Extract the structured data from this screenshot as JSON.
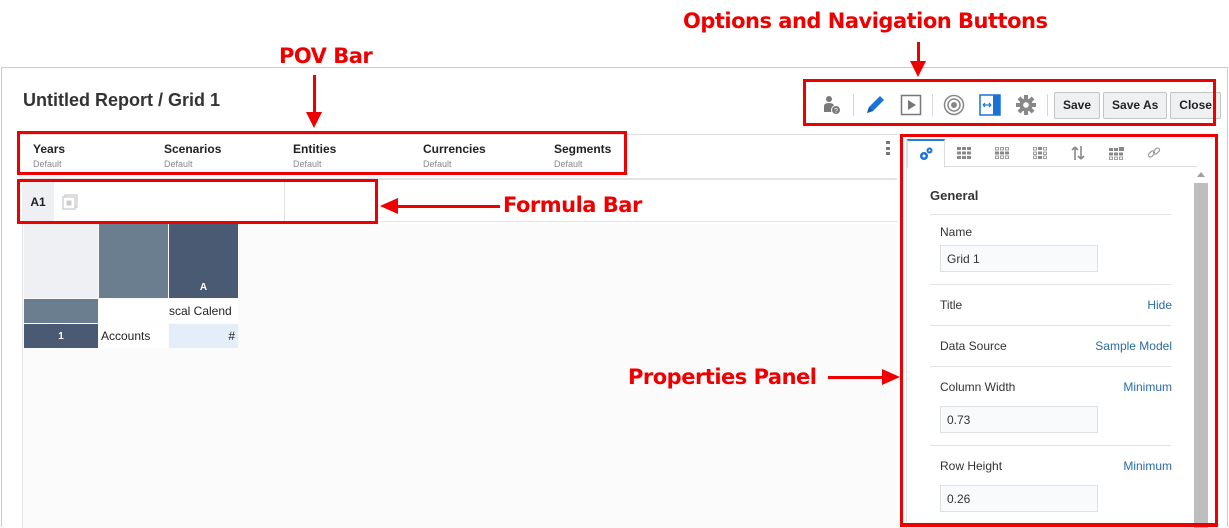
{
  "header": {
    "title": "Untitled Report / Grid 1"
  },
  "toolbar": {
    "icons": [
      "user-help-icon",
      "edit-icon",
      "preview-icon",
      "target-icon",
      "fit-width-icon",
      "settings-icon"
    ],
    "save_label": "Save",
    "save_as_label": "Save As",
    "close_label": "Close"
  },
  "pov": [
    {
      "dimension": "Years",
      "member": "Default"
    },
    {
      "dimension": "Scenarios",
      "member": "Default"
    },
    {
      "dimension": "Entities",
      "member": "Default"
    },
    {
      "dimension": "Currencies",
      "member": "Default"
    },
    {
      "dimension": "Segments",
      "member": "Default"
    }
  ],
  "formula_bar": {
    "cell_ref": "A1",
    "value": ""
  },
  "grid": {
    "column_header": "A",
    "row_header": "1",
    "column_member": "scal Calend",
    "row_member": "Accounts",
    "data_cell": "#"
  },
  "properties": {
    "tabs": [
      "general-tab",
      "grid-tab",
      "row-tab",
      "column-tab",
      "sort-tab",
      "cell-tab",
      "link-tab"
    ],
    "section_title": "General",
    "name_label": "Name",
    "name_value": "Grid 1",
    "title_label": "Title",
    "title_action": "Hide",
    "data_source_label": "Data Source",
    "data_source_value": "Sample Model",
    "column_width_label": "Column Width",
    "column_width_mode": "Minimum",
    "column_width_value": "0.73",
    "row_height_label": "Row Height",
    "row_height_mode": "Minimum",
    "row_height_value": "0.26"
  },
  "annotations": {
    "options": "Options and Navigation Buttons",
    "pov": "POV Bar",
    "formula": "Formula Bar",
    "properties": "Properties Panel"
  },
  "colors": {
    "accent": "#2a7bd1",
    "annotation": "#ee0000",
    "header_dark": "#4a5a72",
    "header_mid": "#6a7e90"
  }
}
